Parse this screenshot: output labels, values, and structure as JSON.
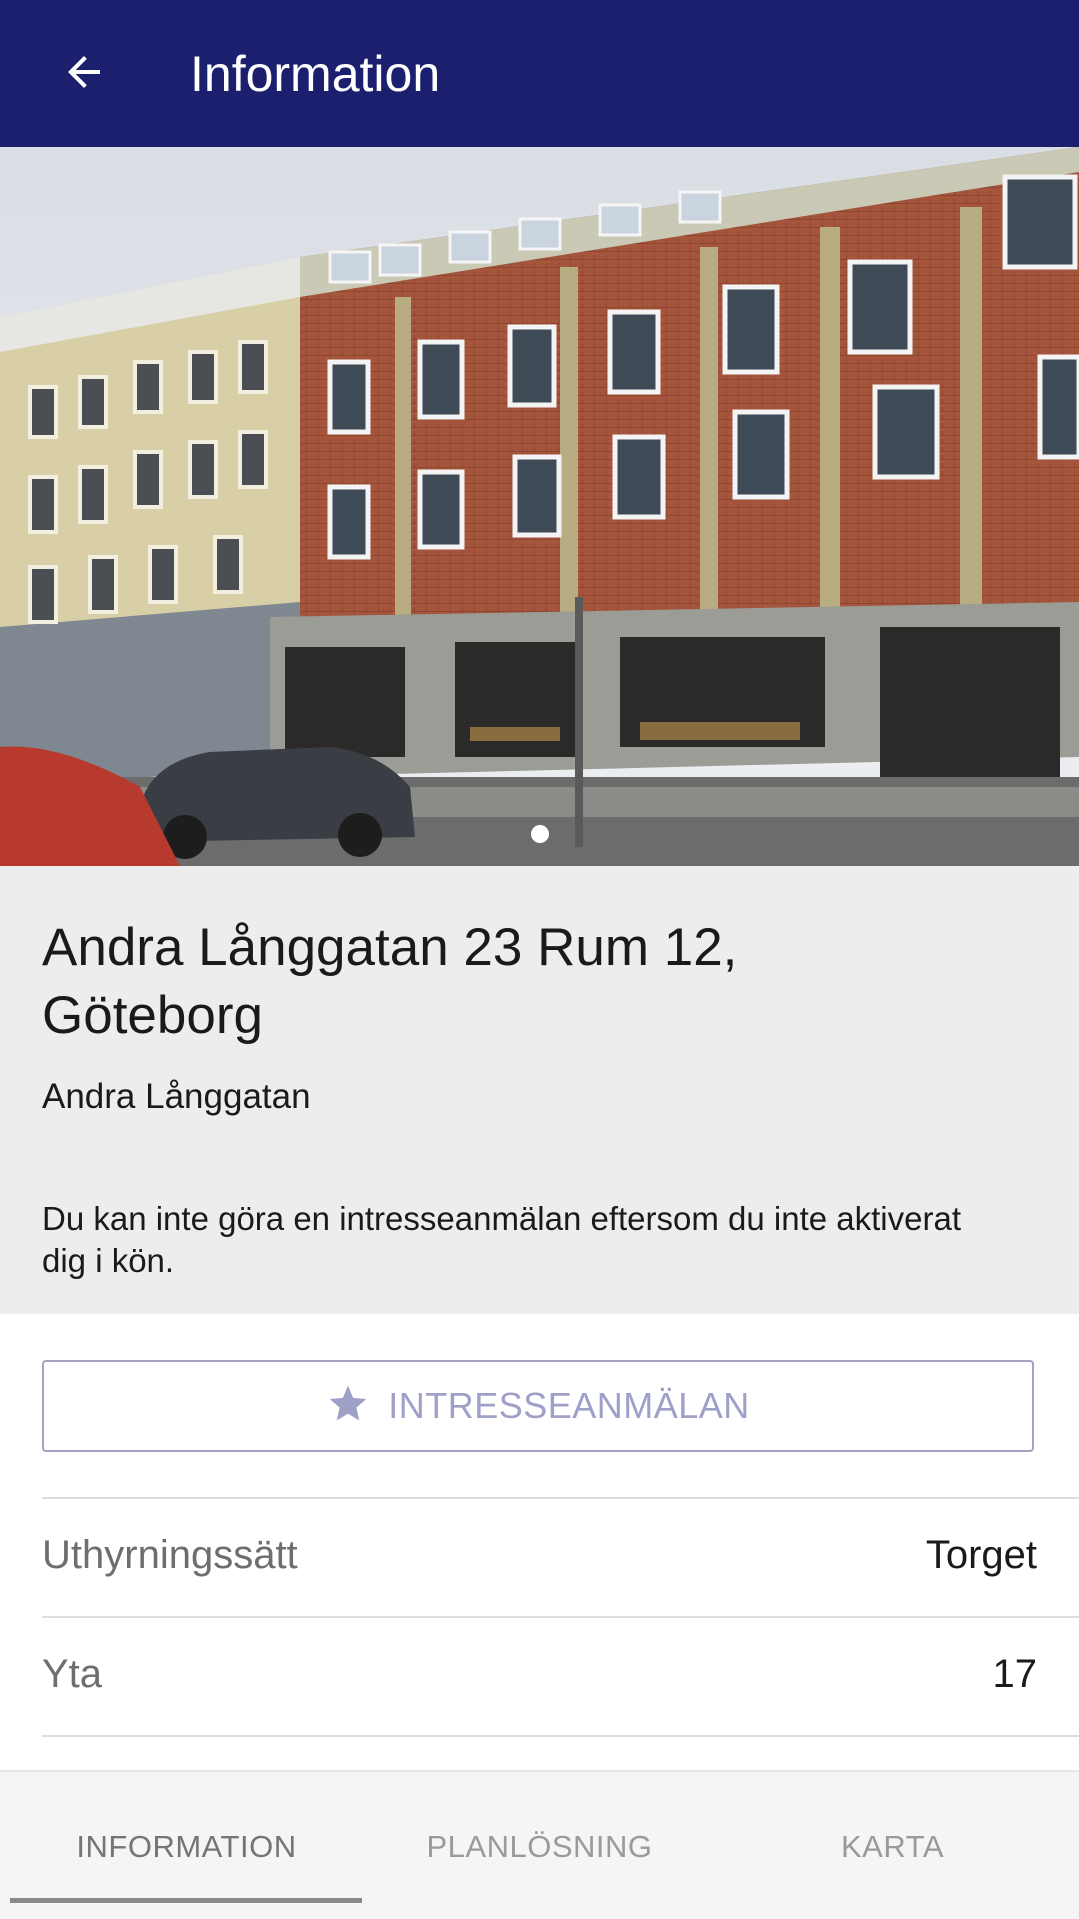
{
  "appbar": {
    "title": "Information",
    "back_icon": "arrow-left-icon",
    "background_color": "#1b1f6e"
  },
  "hero": {
    "image_count": 1,
    "active_index": 0
  },
  "listing": {
    "address": "Andra Långgatan 23 Rum 12, Göteborg",
    "area": "Andra Långgatan",
    "notice": "Du kan inte göra en intresseanmälan eftersom du inte aktiverat dig i kön."
  },
  "actions": {
    "interest_label": "INTRESSEANMÄLAN",
    "interest_icon": "star-icon",
    "accent_color": "#9fa0c8"
  },
  "details": [
    {
      "label": "Uthyrningssätt",
      "value": "Torget"
    },
    {
      "label": "Yta",
      "value": "17"
    }
  ],
  "tabs": [
    {
      "label": "INFORMATION",
      "active": true
    },
    {
      "label": "PLANLÖSNING",
      "active": false
    },
    {
      "label": "KARTA",
      "active": false
    }
  ]
}
